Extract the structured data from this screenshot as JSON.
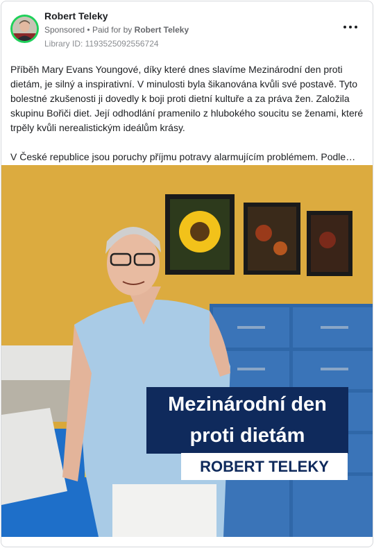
{
  "advertiser": {
    "name": "Robert Teleky",
    "sponsored_label": "Sponsored",
    "paid_for_label": "Paid for by",
    "paid_for_name": "Robert Teleky",
    "library_id": "Library ID: 1193525092556724"
  },
  "menu": {
    "icon": "more-options-icon"
  },
  "post": {
    "paragraph_1": "Příběh Mary Evans Youngové, díky které dnes slavíme Mezinárodní den proti dietám, je silný a inspirativní. V minulosti byla šikanována kvůli své postavě. Tyto bolestné zkušenosti ji dovedly k boji proti dietní kultuře a za práva žen. Založila skupinu Bořiči diet. Její odhodlání pramenilo z hlubokého soucitu se ženami, které trpěly kvůli nerealistickým ideálům krásy.",
    "paragraph_2": "V České republice jsou poruchy příjmu potravy alarmujícím problémem. Podle…"
  },
  "image_overlay": {
    "line_1": "Mezinárodní den",
    "line_2": "proti dietám",
    "line_3": "ROBERT TELEKY"
  },
  "colors": {
    "avatar_ring": "#1fd05a",
    "banner_blue": "#0f2a5c",
    "wall_yellow": "#d9a83a",
    "scrubs_blue": "#a9cbe6"
  }
}
